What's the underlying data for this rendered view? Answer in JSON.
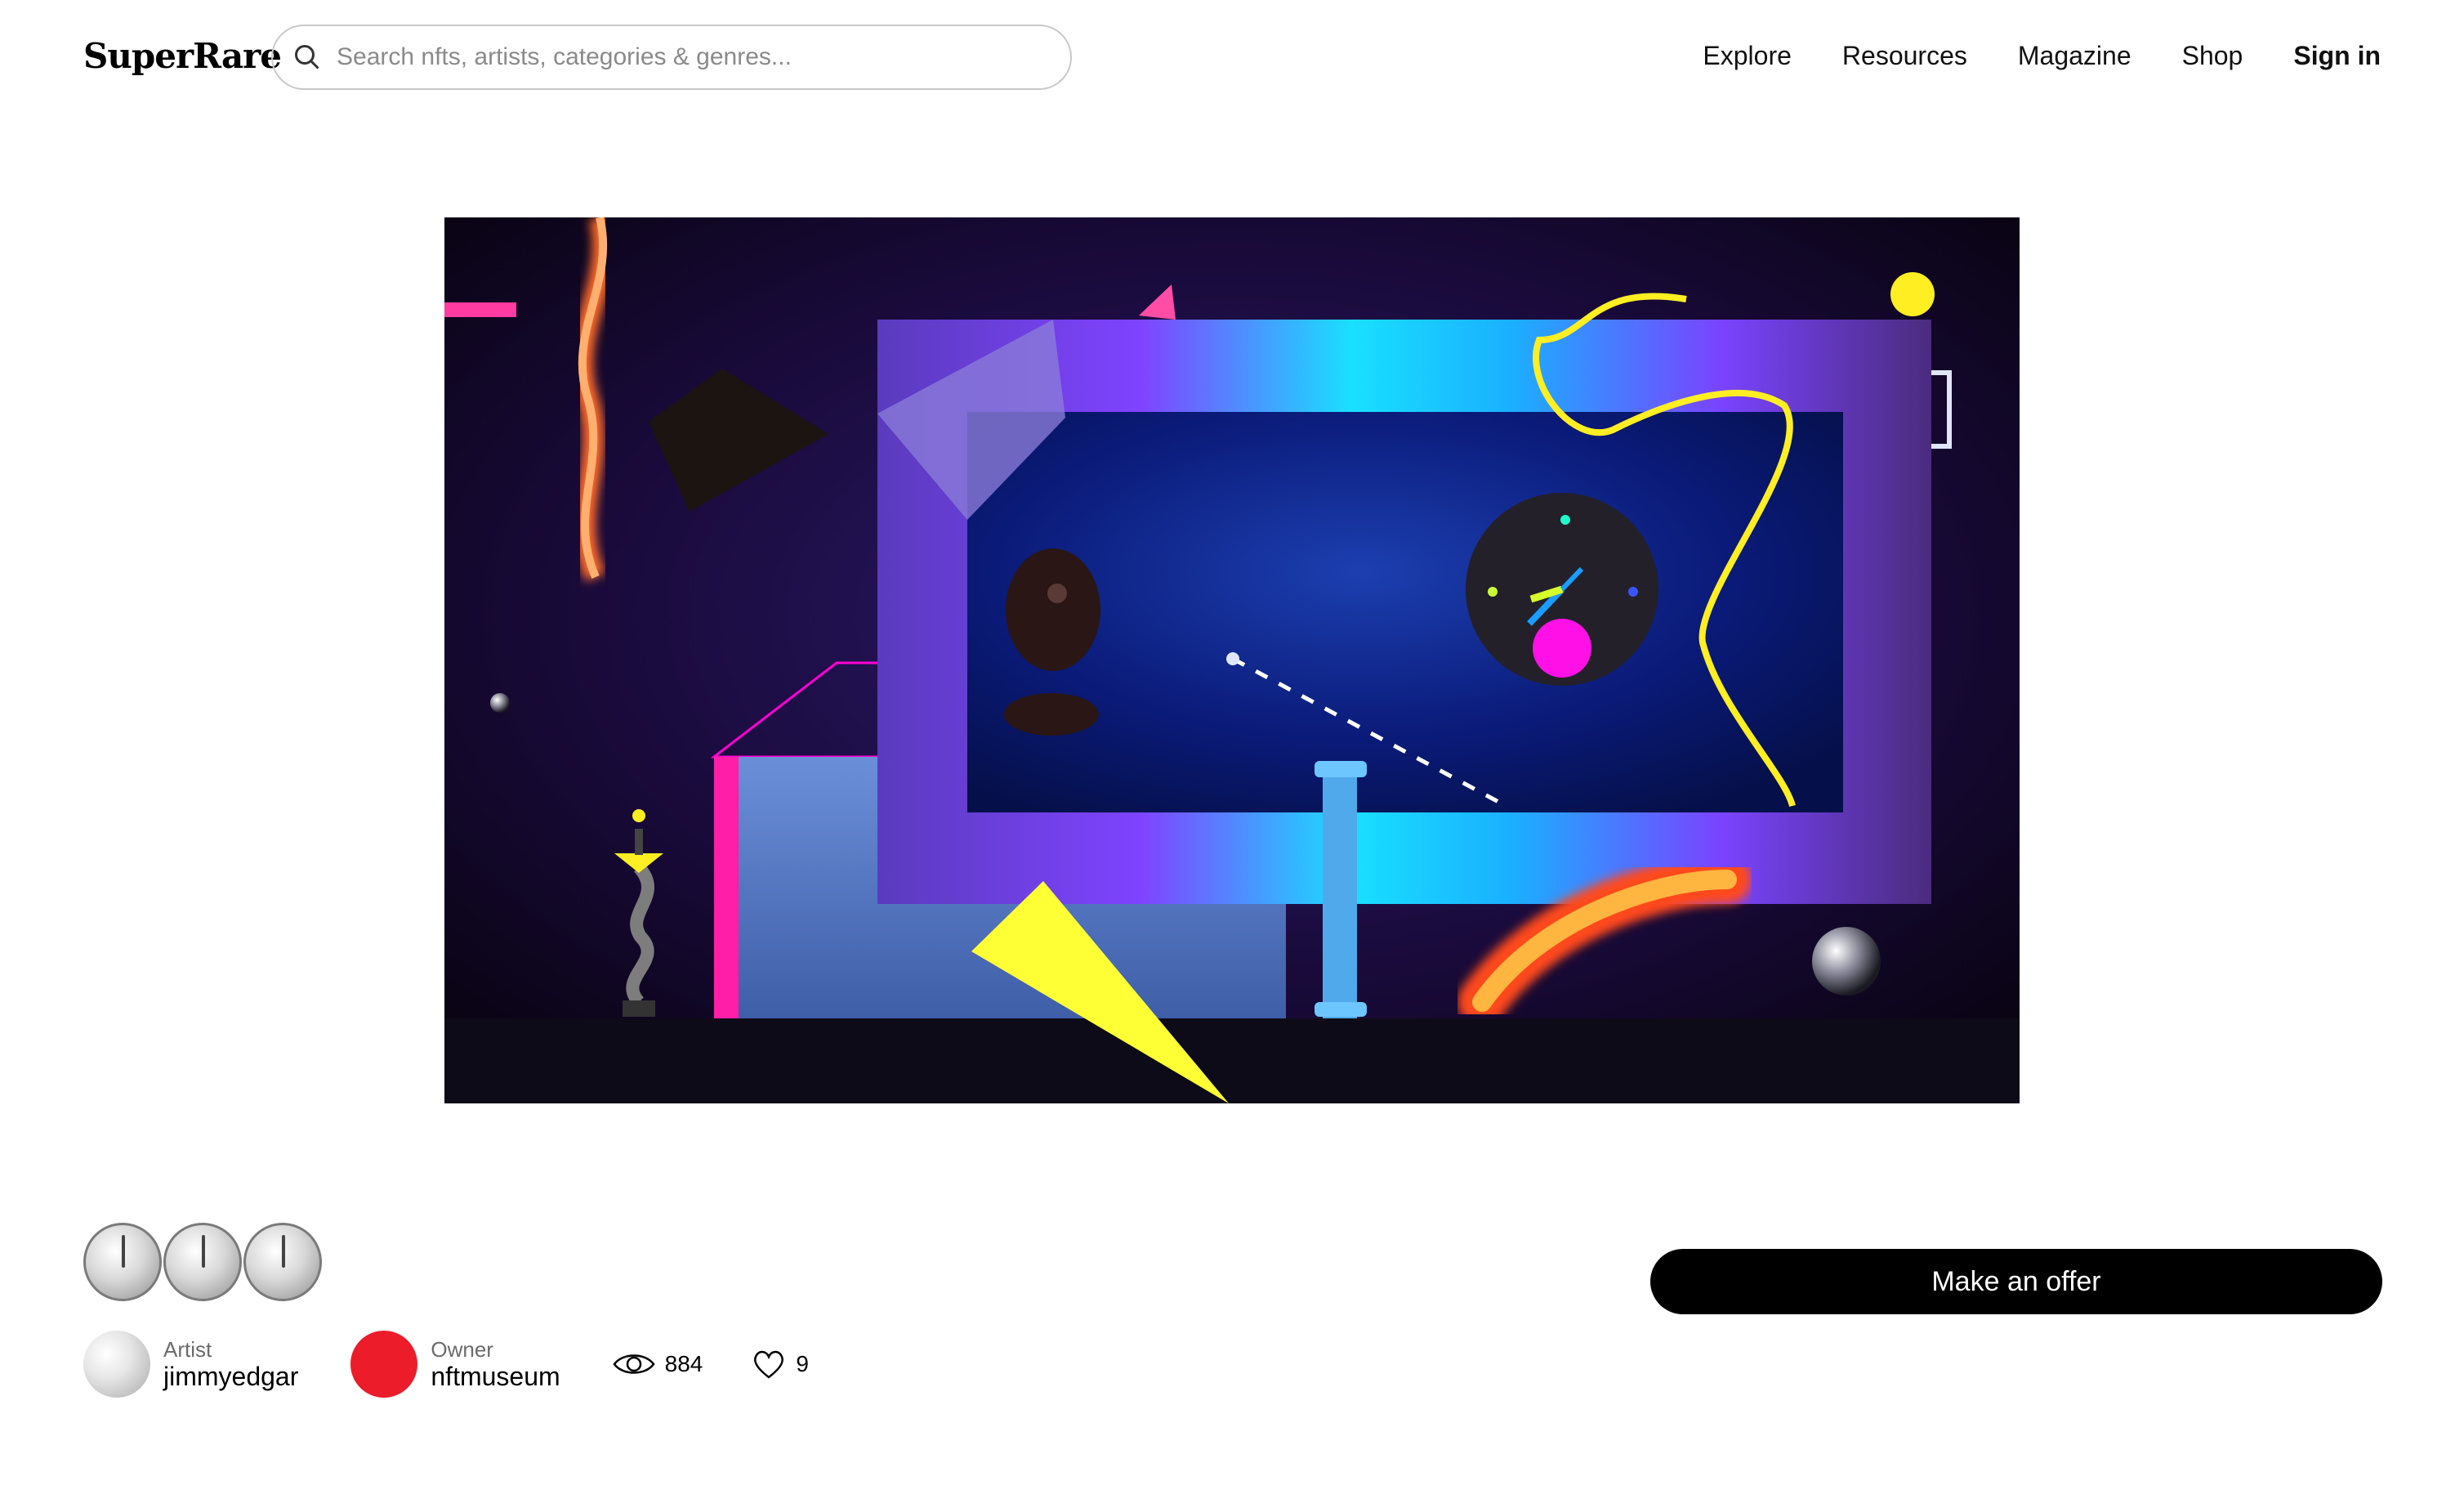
{
  "header": {
    "logo": "SuperRare",
    "search_placeholder": "Search nfts, artists, categories & genres...",
    "nav": [
      "Explore",
      "Resources",
      "Magazine",
      "Shop"
    ],
    "sign_in": "Sign in"
  },
  "offer_button": "Make an offer",
  "artist": {
    "role": "Artist",
    "name": "jimmyedgar"
  },
  "owner": {
    "role": "Owner",
    "name": "nftmuseum"
  },
  "stats": {
    "views": "884",
    "likes": "9"
  }
}
